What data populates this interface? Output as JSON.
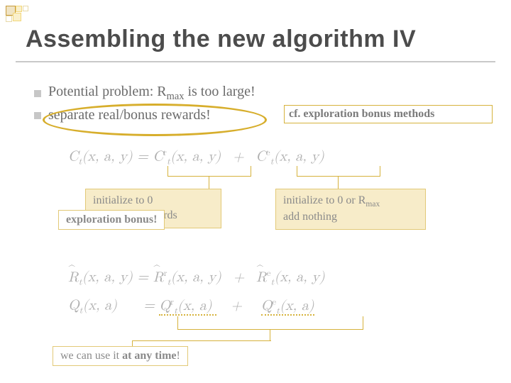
{
  "title": "Assembling the new algorithm IV",
  "bullets": {
    "b1_pre": "Potential problem: R",
    "b1_sub": "max",
    "b1_post": " is too large!",
    "b2": "separate real/bonus rewards!"
  },
  "cf_note": "cf. exploration bonus methods",
  "eq": {
    "C_lhs": "C",
    "args_xay": "(x, a, y)",
    "args_xa": "(x, a)",
    "eq": " = ",
    "plus": " + ",
    "sup_r": "r",
    "sup_e": "e",
    "sub_t": "t",
    "R": "R",
    "Q": "Q"
  },
  "call_left": {
    "l1": "initialize to 0",
    "l2": "add \"real\" rewards"
  },
  "call_left_overlay": "exploration bonus!",
  "call_right": {
    "l1_pre": "initialize to 0 or R",
    "l1_sub": "max",
    "l2": "add nothing"
  },
  "anytime": {
    "pre": "we can use it ",
    "bold": "at any time",
    "post": "!"
  }
}
